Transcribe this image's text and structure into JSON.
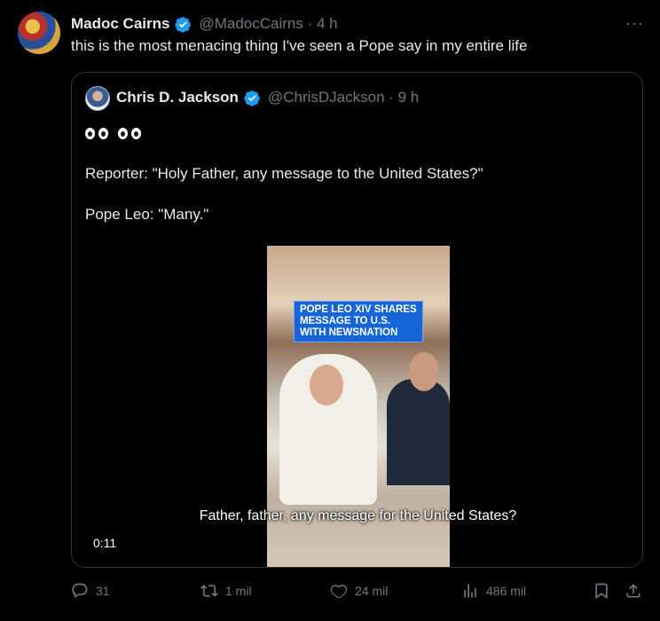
{
  "post": {
    "author_name": "Madoc Cairns",
    "handle_time": "@MadocCairns · 4 h",
    "more_label": "···",
    "text": "this is the most menacing thing I've seen a Pope say in my entire life"
  },
  "quote": {
    "author_name": "Chris D. Jackson",
    "handle_time": "@ChrisDJackson · 9 h",
    "line1": "Reporter: \"Holy Father, any message to the United States?\"",
    "line2": "Pope Leo: \"Many.\""
  },
  "video": {
    "banner_line1": "POPE LEO XIV SHARES",
    "banner_line2": "MESSAGE TO U.S.",
    "banner_line3": "WITH NEWSNATION",
    "caption": "Father, father, any message for the United States?",
    "time": "0:11"
  },
  "actions": {
    "replies": "31",
    "reposts": "1 mil",
    "likes": "24 mil",
    "views": "486 mil"
  },
  "colors": {
    "background": "#000000",
    "text": "#e7e9ea",
    "muted": "#71767b",
    "verified": "#1d9bf0",
    "banner": "#1565d8"
  }
}
